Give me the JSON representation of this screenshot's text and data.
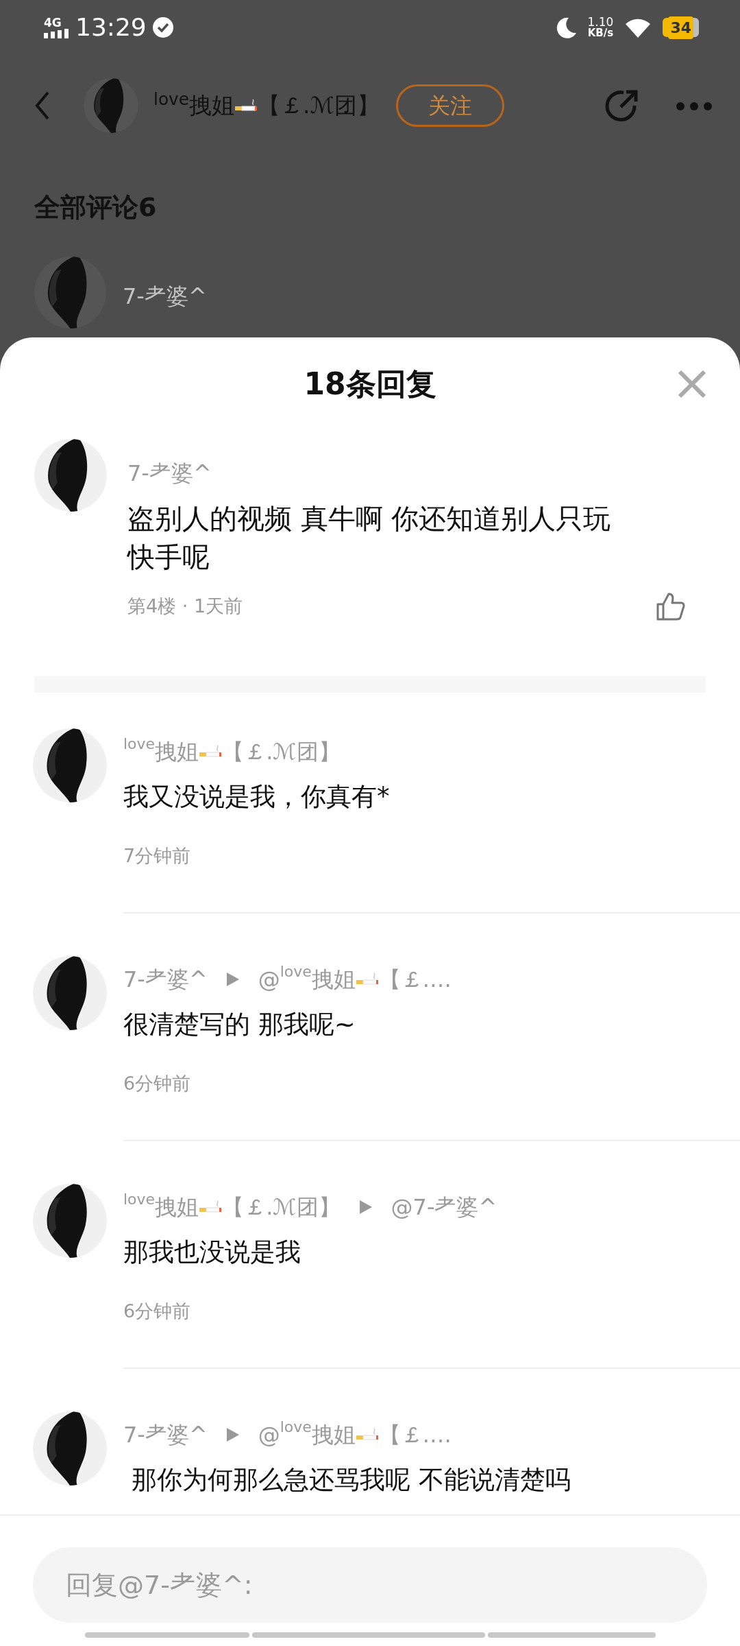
{
  "status_bar": {
    "network": "4G",
    "time": "13:29",
    "speed_value": "1.10",
    "speed_unit": "KB/s",
    "battery": "34"
  },
  "header": {
    "author": [
      {
        "kind": "text",
        "text": "$^{love}$拽姐"
      },
      {
        "kind": "emoji"
      },
      {
        "kind": "text",
        "text": "【￡.ℳ团】"
      }
    ],
    "follow": "关注"
  },
  "comments_title": "全部评论6",
  "preview": {
    "author": [
      {
        "kind": "text",
        "text": "7-⺹婆^"
      }
    ]
  },
  "sheet": {
    "title": "18条回复",
    "main": {
      "author": [
        {
          "kind": "text",
          "text": "7-⺹婆^"
        }
      ],
      "text": "盗别人的视频 真牛啊 你还知道别人只玩快手呢",
      "meta": "第4楼 · 1天前"
    },
    "replies": [
      {
        "author": [
          {
            "kind": "text",
            "text": "$^{love}$拽姐"
          },
          {
            "kind": "emoji"
          },
          {
            "kind": "text",
            "text": "【￡.ℳ团】"
          }
        ],
        "text": "我又没说是我，你真有*",
        "time": "7分钟前"
      },
      {
        "author": [
          {
            "kind": "text",
            "text": "7-⺹婆^"
          }
        ],
        "reply_to": [
          {
            "kind": "text",
            "text": "@$^{love}$拽姐"
          },
          {
            "kind": "emoji"
          },
          {
            "kind": "text",
            "text": "【￡.…"
          }
        ],
        "text": "很清楚写的 那我呢~",
        "time": "6分钟前"
      },
      {
        "author": [
          {
            "kind": "text",
            "text": "$^{love}$拽姐"
          },
          {
            "kind": "emoji"
          },
          {
            "kind": "text",
            "text": "【￡.ℳ团】"
          }
        ],
        "reply_to": [
          {
            "kind": "text",
            "text": "@7-⺹婆^"
          }
        ],
        "text": "那我也没说是我",
        "time": "6分钟前"
      },
      {
        "author": [
          {
            "kind": "text",
            "text": "7-⺹婆^"
          }
        ],
        "reply_to": [
          {
            "kind": "text",
            "text": "@$^{love}$拽姐"
          },
          {
            "kind": "emoji"
          },
          {
            "kind": "text",
            "text": "【￡.…"
          }
        ],
        "text": " 那你为何那么急还骂我呢 不能说清楚吗"
      }
    ],
    "input": {
      "placeholder": "回复@7-⺹婆^:"
    }
  }
}
